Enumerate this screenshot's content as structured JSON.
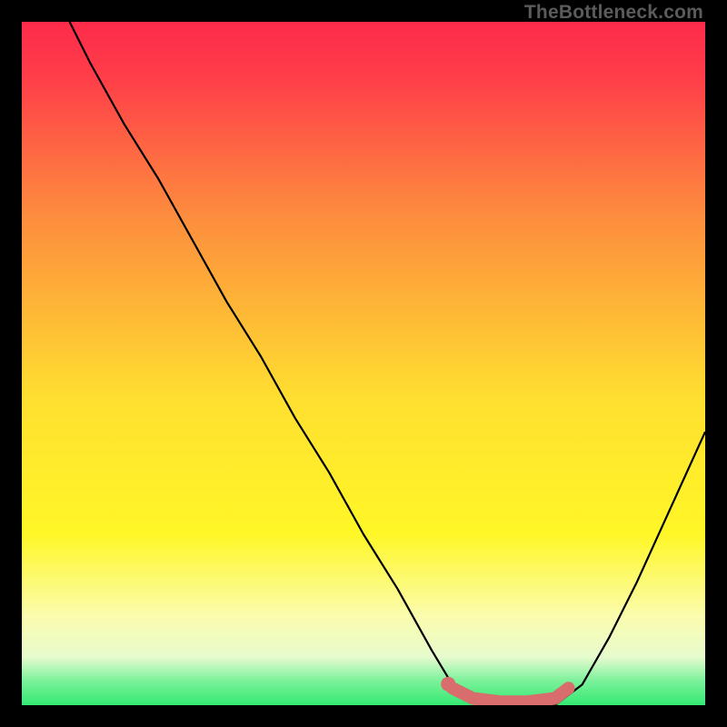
{
  "watermark": "TheBottleneck.com",
  "chart_data": {
    "type": "line",
    "title": "",
    "xlabel": "",
    "ylabel": "",
    "xlim": [
      0,
      100
    ],
    "ylim": [
      0,
      100
    ],
    "grid": false,
    "legend": false,
    "background_gradient": {
      "top": "#fe2b4a",
      "mid1": "#fd8b3e",
      "mid2": "#fff12a",
      "mid3": "#fdfdc6",
      "bottom": "#34e972"
    },
    "series": [
      {
        "name": "bottleneck-curve",
        "color": "#000000",
        "x": [
          7,
          10,
          15,
          20,
          25,
          30,
          35,
          40,
          45,
          50,
          55,
          60,
          63,
          66,
          70,
          74,
          78,
          82,
          86,
          90,
          95,
          100
        ],
        "y": [
          100,
          94,
          85,
          77,
          68,
          59,
          51,
          42,
          34,
          25,
          17,
          8,
          3,
          1,
          0,
          0,
          0,
          3,
          10,
          18,
          29,
          40
        ]
      },
      {
        "name": "optimal-range-marker",
        "color": "#d96c6c",
        "style": "thick-dotted",
        "x": [
          63,
          66,
          70,
          74,
          78,
          80
        ],
        "y": [
          2.5,
          1,
          0.5,
          0.5,
          1,
          2.5
        ]
      }
    ],
    "annotations": []
  }
}
